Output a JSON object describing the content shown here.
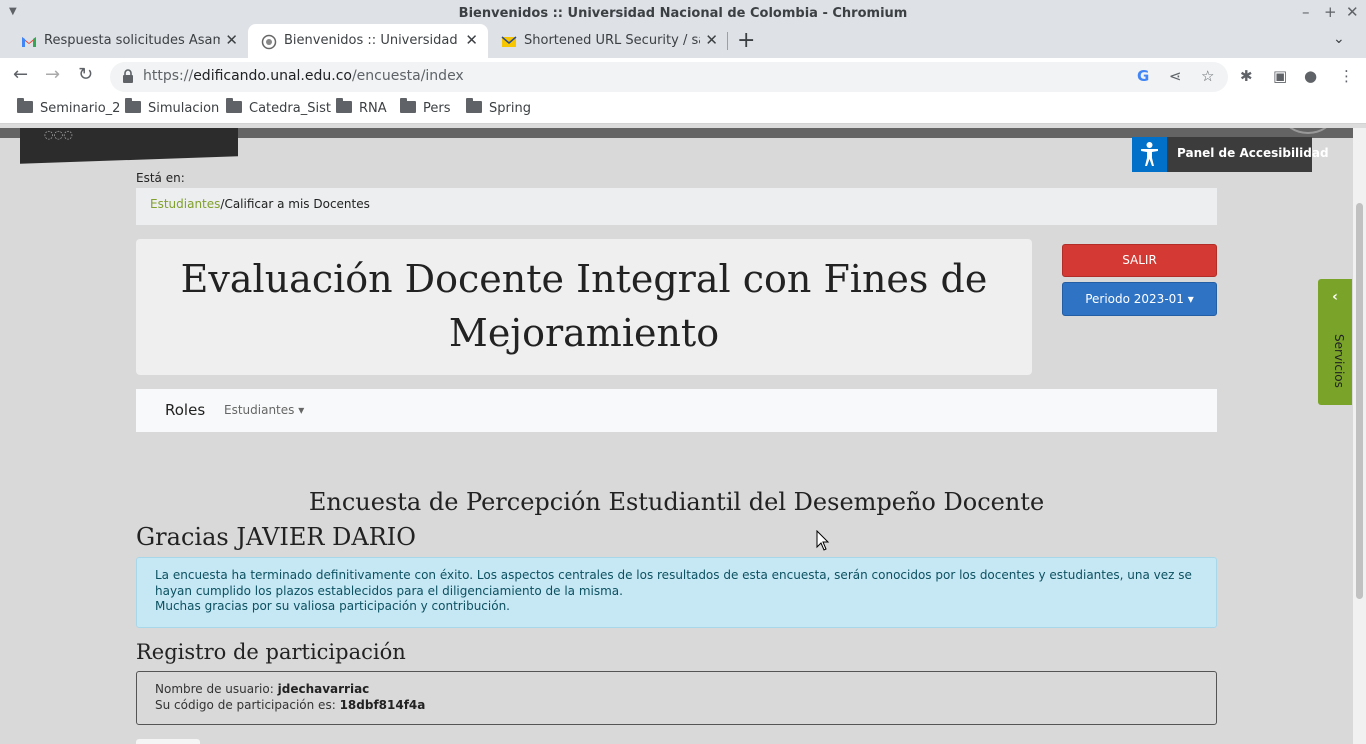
{
  "window": {
    "title": "Bienvenidos :: Universidad Nacional de Colombia - Chromium"
  },
  "tabs": [
    {
      "title": "Respuesta solicitudes Asamblea",
      "favicon": "gmail-icon"
    },
    {
      "title": "Bienvenidos :: Universidad Nacional",
      "favicon": "unal-seal-icon"
    },
    {
      "title": "Shortened URL Security / safecom",
      "favicon": "mail-icon"
    }
  ],
  "address": {
    "protocol": "https://",
    "host": "edificando.unal.edu.co",
    "path": "/encuesta/index"
  },
  "bookmarks": [
    "Seminario_2",
    "Simulacion",
    "Catedra_Sist",
    "RNA",
    "Pers",
    "Spring"
  ],
  "accessibility": {
    "label": "Panel de Accesibilidad"
  },
  "breadcrumb": {
    "label": "Está en:",
    "link": "Estudiantes",
    "current": "/Calificar a mis Docentes"
  },
  "header": {
    "title": "Evaluación Docente Integral con Fines de Mejoramiento"
  },
  "actions": {
    "salir": "SALIR",
    "periodo": "Periodo 2023-01"
  },
  "nav": {
    "brand": "Roles",
    "dropdown": "Estudiantes"
  },
  "survey": {
    "heading": "Encuesta de Percepción Estudiantil del Desempeño Docente",
    "thanks": "Gracias JAVIER DARIO",
    "alert_line1": "La encuesta ha terminado definitivamente con éxito. Los aspectos centrales de los resultados de esta encuesta, serán conocidos por los docentes y estudiantes, una vez se hayan cumplido los plazos establecidos para el diligenciamiento de la misma.",
    "alert_line2": "Muchas gracias por su valiosa participación y contribución."
  },
  "registro": {
    "heading": "Registro de participación",
    "user_label": "Nombre de usuario:",
    "user_value": "jdechavarriac",
    "code_label": "Su código de participación es:",
    "code_value": "18dbf814f4a"
  },
  "servicios": {
    "label": "Servicios"
  },
  "colors": {
    "salir": "#d43a33",
    "periodo": "#2f73c4",
    "servicios": "#7aa429",
    "access": "#0070c9",
    "link": "#82a02d"
  }
}
